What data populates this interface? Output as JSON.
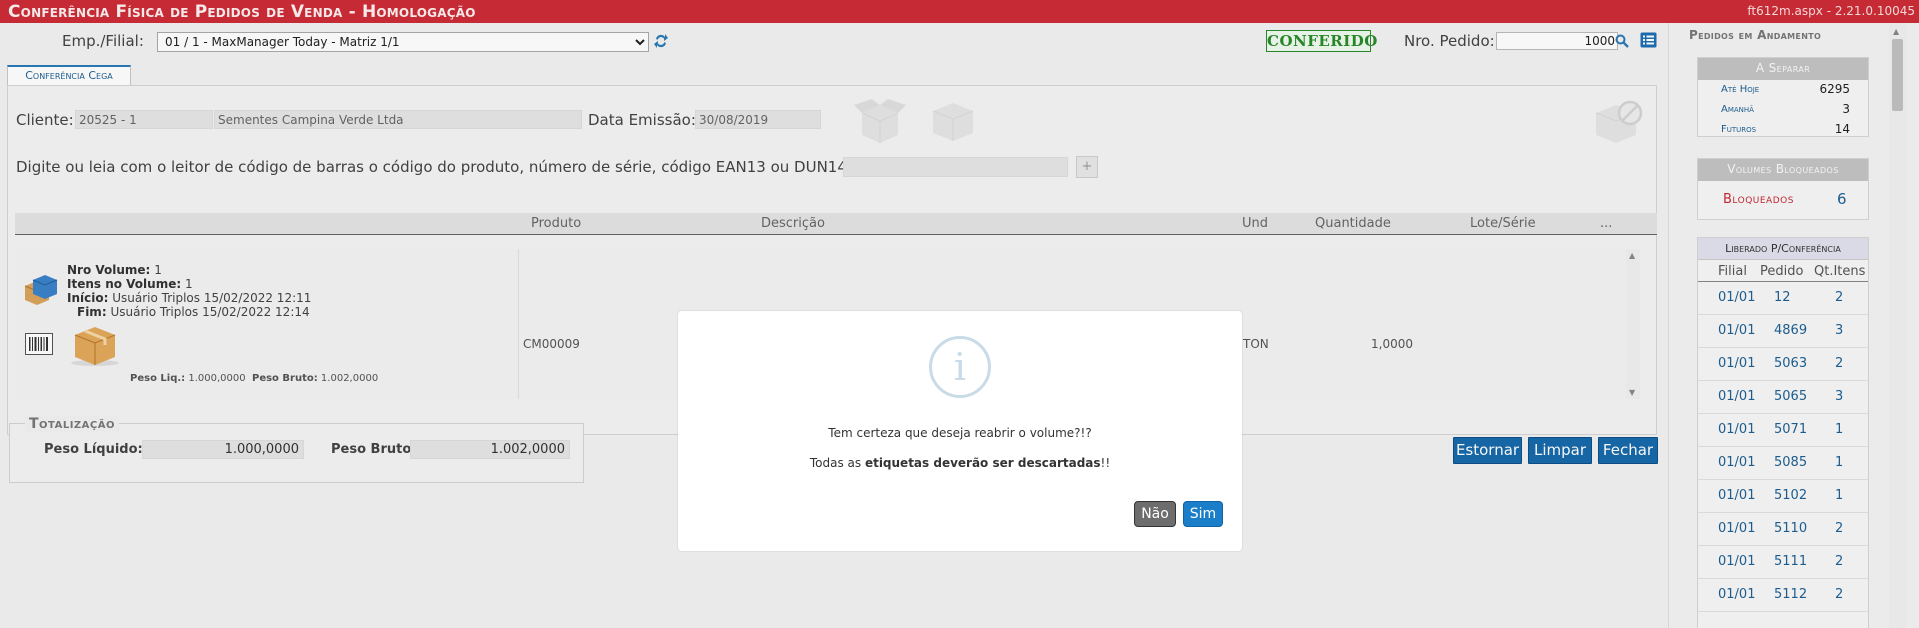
{
  "titlebar": {
    "title": "Conferência Física de Pedidos de Venda  - Homologação",
    "version": "ft612m.aspx - 2.21.0.10045"
  },
  "toolbar": {
    "emp_label": "Emp./Filial:",
    "emp_value": "01 / 1 - MaxManager Today - Matriz 1/1",
    "status_badge": "CONFERIDO",
    "pedido_label": "Nro. Pedido:",
    "pedido_value": "1000"
  },
  "tab": {
    "label": "Conferência Cega"
  },
  "cliente": {
    "label": "Cliente:",
    "codigo": "20525 - 1",
    "nome": "Sementes Campina Verde Ltda",
    "data_label": "Data Emissão:",
    "data_value": "30/08/2019"
  },
  "barcode": {
    "instruction": "Digite ou leia com o leitor de código de barras o código do produto, número de série, código EAN13 ou DUN14:",
    "add_label": "+"
  },
  "grid": {
    "columns": [
      "Produto",
      "Descrição",
      "Und",
      "Quantidade",
      "Lote/Série",
      "..."
    ],
    "volume": {
      "nro_label": "Nro Volume:",
      "nro_value": "1",
      "itens_label": "Itens no Volume:",
      "itens_value": "1",
      "inicio_label": "Início:",
      "inicio_value": "Usuário Triplos 15/02/2022 12:11",
      "fim_label": "Fim:",
      "fim_value": "Usuário Triplos 15/02/2022 12:14",
      "peso_liq_label": "Peso Liq.:",
      "peso_liq_value": "1.000,0000",
      "peso_bruto_label": "Peso Bruto:",
      "peso_bruto_value": "1.002,0000"
    },
    "row": {
      "produto": "CM00009",
      "und": "TON",
      "quantidade": "1,0000"
    }
  },
  "totalizacao": {
    "title": "Totalização",
    "peso_liquido_label": "Peso Líquido:",
    "peso_liquido_value": "1.000,0000",
    "peso_bruto_label": "Peso Bruto:",
    "peso_bruto_value": "1.002,0000"
  },
  "actions": {
    "estornar": "Estornar",
    "limpar": "Limpar",
    "fechar": "Fechar"
  },
  "sidebar": {
    "title": "Pedidos em Andamento",
    "a_separar": {
      "title": "A Separar",
      "rows": [
        {
          "label": "Até Hoje",
          "value": "6295"
        },
        {
          "label": "Amanhã",
          "value": "3"
        },
        {
          "label": "Futuros",
          "value": "14"
        }
      ]
    },
    "volumes_bloqueados": {
      "title": "Volumes Bloqueados",
      "label": "Bloqueados",
      "value": "6"
    },
    "liberado": {
      "title": "Liberado P/Conferência",
      "columns": [
        "Filial",
        "Pedido",
        "Qt.Itens"
      ],
      "rows": [
        {
          "filial": "01/01",
          "pedido": "12",
          "qt": "2"
        },
        {
          "filial": "01/01",
          "pedido": "4869",
          "qt": "3"
        },
        {
          "filial": "01/01",
          "pedido": "5063",
          "qt": "2"
        },
        {
          "filial": "01/01",
          "pedido": "5065",
          "qt": "3"
        },
        {
          "filial": "01/01",
          "pedido": "5071",
          "qt": "1"
        },
        {
          "filial": "01/01",
          "pedido": "5085",
          "qt": "1"
        },
        {
          "filial": "01/01",
          "pedido": "5102",
          "qt": "1"
        },
        {
          "filial": "01/01",
          "pedido": "5110",
          "qt": "2"
        },
        {
          "filial": "01/01",
          "pedido": "5111",
          "qt": "2"
        },
        {
          "filial": "01/01",
          "pedido": "5112",
          "qt": "2"
        }
      ]
    }
  },
  "dialog": {
    "icon": "info-icon",
    "question": "Tem certeza que deseja reabrir o volume?!?",
    "warn_prefix": "Todas as ",
    "warn_bold": "etiquetas deverão ser descartadas",
    "warn_suffix": "!!",
    "no_label": "Não",
    "yes_label": "Sim"
  }
}
